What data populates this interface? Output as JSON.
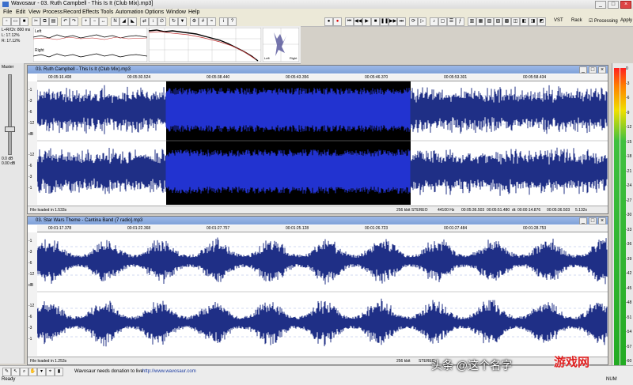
{
  "window": {
    "title": "Wavosaur - 03. Ruth Campbell - This Is It (Club Mix).mp3]",
    "buttons": [
      "_",
      "□",
      "×"
    ]
  },
  "menu": [
    "File",
    "Edit",
    "View",
    "Process",
    "Record",
    "Effects",
    "Tools",
    "Automation",
    "Options",
    "Window",
    "Help"
  ],
  "toolbar": {
    "vst_label": "VST",
    "rack_label": "Rack",
    "processing_label": "Processing",
    "apply_label": "Apply"
  },
  "analysis": {
    "level_lines": [
      "L+R/Ch: 800 ms",
      "L: 17.12%",
      "R: 17.12%"
    ],
    "graph_left_label": "Left",
    "graph_right_label": "Right",
    "scope_left": "Left",
    "scope_right": "Right"
  },
  "master": {
    "label": "Master",
    "db": "0.0 dB",
    "db2": "0.00 dB"
  },
  "wave1": {
    "title": "03. Ruth Campbell - This Is It (Club Mix).mp3",
    "ruler": [
      "00:05:16.408",
      "00:05:30.524",
      "00:05:38.440",
      "00:05:43.356",
      "00:05:46.370",
      "00:05:53.301",
      "00:05:58.434"
    ],
    "scale": [
      "-1",
      "-3",
      "-6",
      "-12",
      "dB",
      "-12",
      "-6",
      "-3",
      "-1"
    ],
    "status_left": "File loaded in 1.533s",
    "status_right": [
      "256 kbit STEREO",
      "44100 Hz",
      "00:05:36.503",
      "00:05:51.480",
      "dt: 00:00:14.876",
      "00:05:36.503",
      "5.132x"
    ]
  },
  "wave2": {
    "title": "03. Star Wars Theme - Cantina Band (7 radio].mp3",
    "ruler": [
      "00:01:17.378",
      "00:01:22.368",
      "00:01:27.757",
      "00:01:25.128",
      "00:01:26.723",
      "00:01:27.484",
      "00:01:28.753"
    ],
    "scale": [
      "-1",
      "-3",
      "-6",
      "-12",
      "dB",
      "-12",
      "-6",
      "-3",
      "-1"
    ],
    "status_left": "File loaded in 1.253s",
    "status_right": [
      "256 kbit",
      "STEREO"
    ]
  },
  "meter_ticks": [
    "0",
    "-3",
    "-6",
    "-9",
    "-12",
    "-15",
    "-18",
    "-21",
    "-24",
    "-27",
    "-30",
    "-33",
    "-36",
    "-39",
    "-42",
    "-45",
    "-48",
    "-51",
    "-54",
    "-57",
    "-60"
  ],
  "bottom": {
    "ready": "Ready",
    "num": "NUM",
    "status_msg": "Wavosaur needs donation to live",
    "site": "http://www.wavosaur.com"
  },
  "colors": {
    "wave_dark": "#1f2f86",
    "wave_bright": "#2233d0",
    "selection_bg": "#000000"
  },
  "watermark": {
    "text": "头条 @这个名字",
    "logo": "游戏网"
  }
}
